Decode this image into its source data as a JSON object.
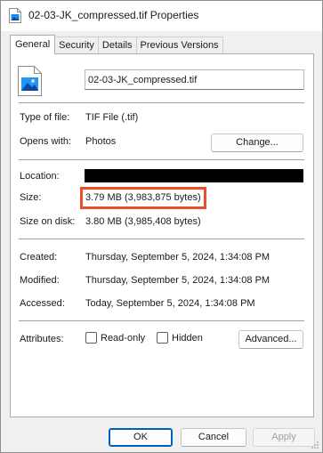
{
  "window": {
    "title": "02-03-JK_compressed.tif Properties",
    "accent": "#005fb8",
    "highlight_color": "#e8512a"
  },
  "tabs": [
    {
      "label": "General",
      "active": true
    },
    {
      "label": "Security",
      "active": false
    },
    {
      "label": "Details",
      "active": false
    },
    {
      "label": "Previous Versions",
      "active": false
    }
  ],
  "general": {
    "file_name": "02-03-JK_compressed.tif",
    "type_of_file_label": "Type of file:",
    "type_of_file_value": "TIF File (.tif)",
    "opens_with_label": "Opens with:",
    "opens_with_value": "Photos",
    "change_button": "Change...",
    "location_label": "Location:",
    "size_label": "Size:",
    "size_value": "3.79 MB (3,983,875 bytes)",
    "size_on_disk_label": "Size on disk:",
    "size_on_disk_value": "3.80 MB (3,985,408 bytes)",
    "created_label": "Created:",
    "created_value": "Thursday, September 5, 2024, 1:34:08 PM",
    "modified_label": "Modified:",
    "modified_value": "Thursday, September 5, 2024, 1:34:08 PM",
    "accessed_label": "Accessed:",
    "accessed_value": "Today, September 5, 2024, 1:34:08 PM",
    "attributes_label": "Attributes:",
    "readonly_label": "Read-only",
    "hidden_label": "Hidden",
    "advanced_button": "Advanced..."
  },
  "footer": {
    "ok": "OK",
    "cancel": "Cancel",
    "apply": "Apply"
  }
}
